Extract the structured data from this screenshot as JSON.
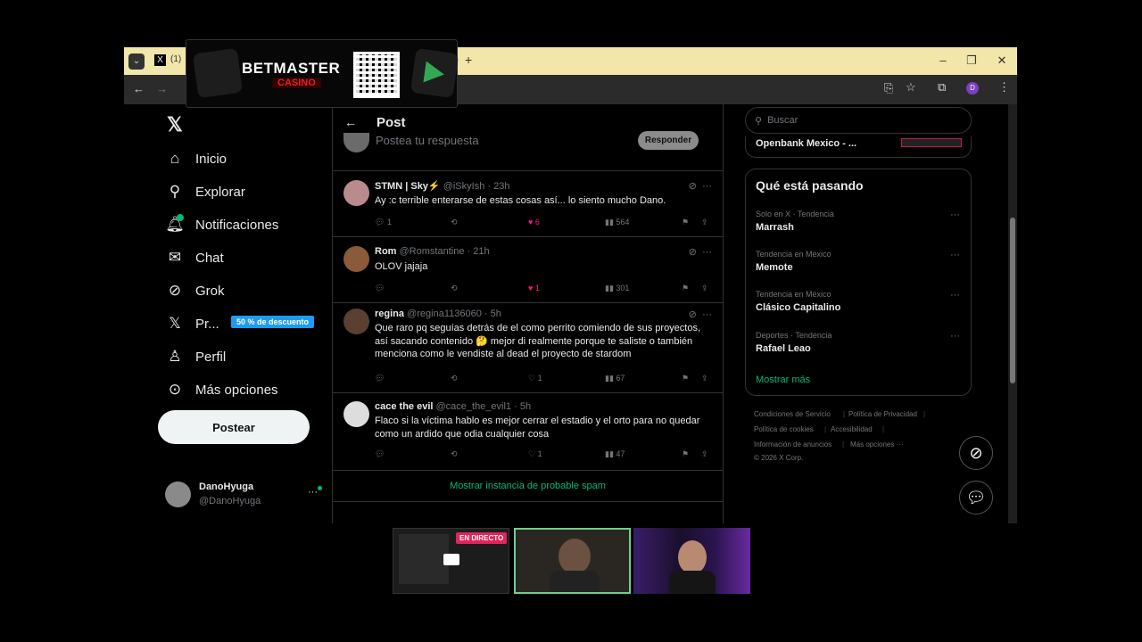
{
  "ad": {
    "brand": "BETMASTER",
    "sub": "CASINO"
  },
  "browser": {
    "tab_title": "(1)"
  },
  "nav": {
    "items": [
      {
        "label": "Inicio",
        "icon": "home-icon"
      },
      {
        "label": "Explorar",
        "icon": "search-icon"
      },
      {
        "label": "Notificaciones",
        "icon": "bell-icon"
      },
      {
        "label": "Chat",
        "icon": "mail-icon"
      },
      {
        "label": "Grok",
        "icon": "grok-icon"
      },
      {
        "label": "Pr...",
        "icon": "x-logo-icon"
      },
      {
        "label": "Perfil",
        "icon": "person-icon"
      },
      {
        "label": "Más opciones",
        "icon": "more-icon"
      }
    ],
    "promo": "50 % de descuento",
    "post_button": "Postear",
    "user_name": "DanoHyuga",
    "user_handle": "@DanoHyuga"
  },
  "center": {
    "title": "Post",
    "reply_placeholder": "Postea tu respuesta",
    "reply_button": "Responder",
    "replies": [
      {
        "name": "STMN  | Sky⚡",
        "handle": "@iSkyIsh · 23h",
        "text": "Ay :c terrible enterarse de estas cosas así... lo siento mucho Dano.",
        "replies": "1",
        "likes": "6",
        "views": "564"
      },
      {
        "name": "Rom",
        "handle": "@Romstantine · 21h",
        "text": "OLOV jajaja",
        "replies": "",
        "likes": "1",
        "views": "301"
      },
      {
        "name": "regina",
        "handle": "@regina1136060 · 5h",
        "text": "Que raro pq seguías detrás de el como perrito comiendo de sus proyectos, así sacando contenido 🤔 mejor di realmente porque te saliste o también menciona como le vendiste al dead el proyecto de stardom",
        "replies": "",
        "likes": "1",
        "views": "67"
      },
      {
        "name": "cace the evil",
        "handle": "@cace_the_evil1 · 5h",
        "text": "Flaco si la víctima hablo es mejor cerrar el estadio y el orto para no quedar como un ardido que odia cualquier cosa",
        "replies": "",
        "likes": "1",
        "views": "47"
      }
    ],
    "spam_link": "Mostrar instancia de probable spam"
  },
  "right": {
    "search_placeholder": "Buscar",
    "ad_partial": "Openbank Mexico - ...",
    "trending_title": "Qué está pasando",
    "trends": [
      {
        "meta": "Solo en X · Tendencia",
        "name": "Marrash"
      },
      {
        "meta": "Tendencia en México",
        "name": "Memote"
      },
      {
        "meta": "Tendencia en México",
        "name": "Clásico Capitalino"
      },
      {
        "meta": "Deportes · Tendencia",
        "name": "Rafael Leao"
      }
    ],
    "show_more": "Mostrar más",
    "footer": [
      "Condiciones de Servicio",
      "Política de Privacidad",
      "Política de cookies",
      "Accesibilidad",
      "Información de anuncios",
      "Más opciones ···",
      "© 2026 X Corp."
    ]
  },
  "stream": {
    "live_badge": "EN DIRECTO"
  },
  "colors": {
    "accent_green": "#00ba7c",
    "like_pink": "#f91880",
    "promo_blue": "#1d9bf0"
  }
}
